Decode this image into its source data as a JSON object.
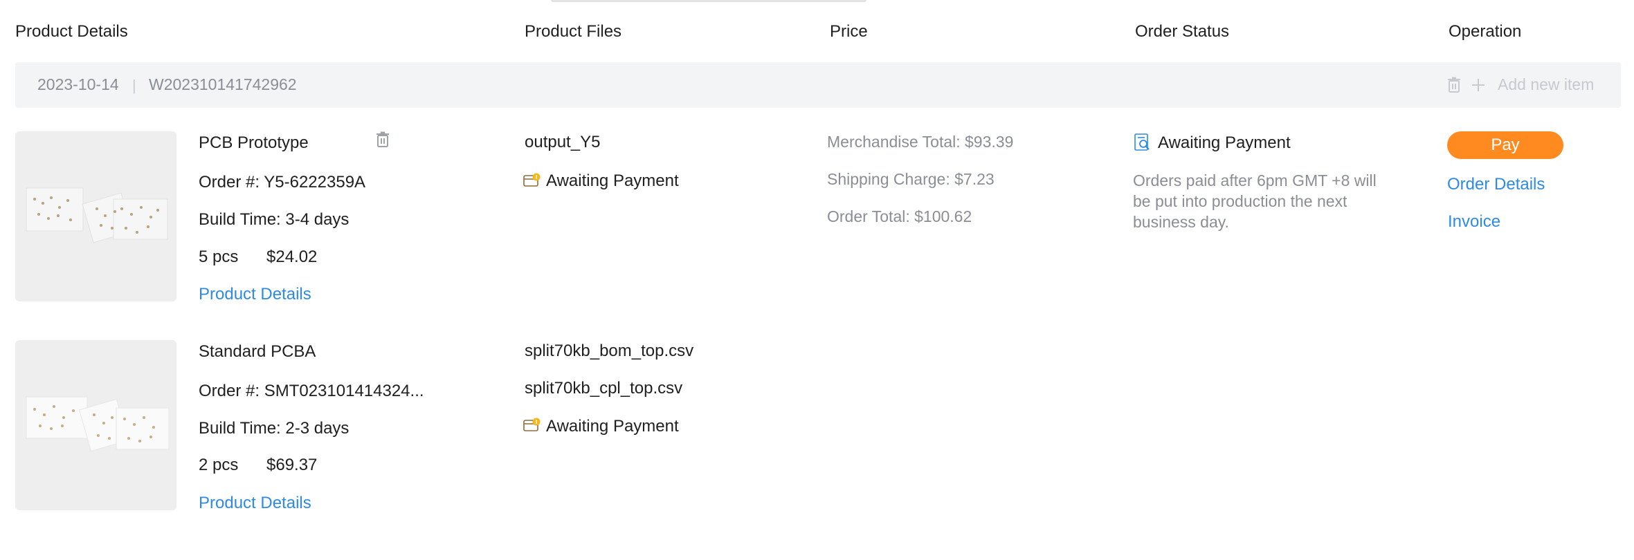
{
  "headers": {
    "product_details": "Product Details",
    "product_files": "Product Files",
    "price": "Price",
    "order_status": "Order Status",
    "operation": "Operation"
  },
  "order": {
    "date": "2023-10-14",
    "separator": "|",
    "number": "W202310141742962",
    "add_label": "Add new item"
  },
  "items": [
    {
      "name": "PCB Prototype",
      "order_number": "Order #: Y5-6222359A",
      "build_time": "Build Time: 3-4 days",
      "qty": "5 pcs",
      "price": "$24.02",
      "details_link": "Product Details",
      "files": [
        "output_Y5"
      ],
      "file_status": "Awaiting Payment"
    },
    {
      "name": "Standard PCBA",
      "order_number": "Order #: SMT023101414324...",
      "build_time": "Build Time: 2-3 days",
      "qty": "2 pcs",
      "price": "$69.37",
      "details_link": "Product Details",
      "files": [
        "split70kb_bom_top.csv",
        "split70kb_cpl_top.csv"
      ],
      "file_status": "Awaiting Payment"
    }
  ],
  "price": {
    "merchandise": "Merchandise Total: $93.39",
    "shipping": "Shipping Charge: $7.23",
    "total": "Order Total: $100.62"
  },
  "status": {
    "label": "Awaiting Payment",
    "note": "Orders paid after 6pm GMT +8 will be put into production the next business day."
  },
  "operation": {
    "pay": "Pay",
    "order_details": "Order Details",
    "invoice": "Invoice"
  },
  "colors": {
    "accent_orange": "#ff8a1f",
    "link_blue": "#2d8ae6",
    "muted_gray": "#8a8e94",
    "bar_bg": "#f3f4f6"
  },
  "icons": {
    "delete": "trash-icon",
    "add": "plus-icon",
    "file_status": "payment-card-icon",
    "order_status": "search-document-icon"
  }
}
